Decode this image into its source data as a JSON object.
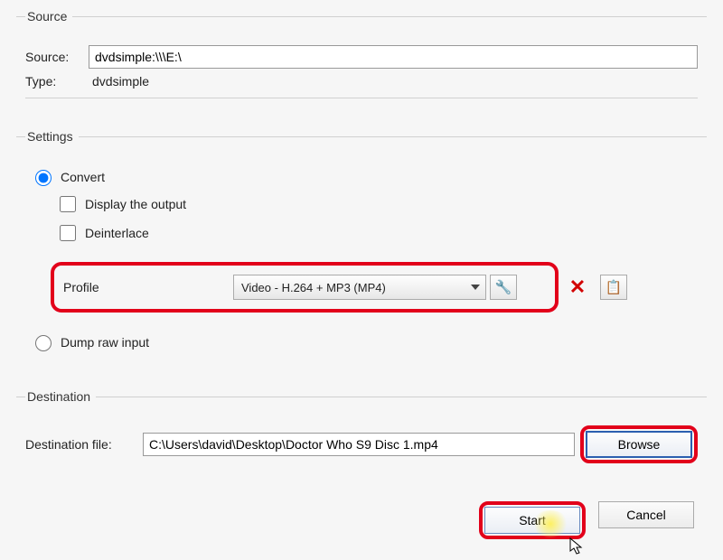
{
  "source": {
    "legend": "Source",
    "source_label": "Source:",
    "source_value": "dvdsimple:\\\\\\E:\\",
    "type_label": "Type:",
    "type_value": "dvdsimple"
  },
  "settings": {
    "legend": "Settings",
    "convert_label": "Convert",
    "display_output_label": "Display the output",
    "deinterlace_label": "Deinterlace",
    "profile_label": "Profile",
    "profile_value": "Video - H.264 + MP3 (MP4)",
    "dump_label": "Dump raw input"
  },
  "destination": {
    "legend": "Destination",
    "file_label": "Destination file:",
    "file_value": "C:\\Users\\david\\Desktop\\Doctor Who S9 Disc 1.mp4",
    "browse_label": "Browse"
  },
  "footer": {
    "start_label": "Start",
    "cancel_label": "Cancel"
  },
  "icons": {
    "wrench": "🔧",
    "delete": "✕",
    "list": "📋"
  }
}
